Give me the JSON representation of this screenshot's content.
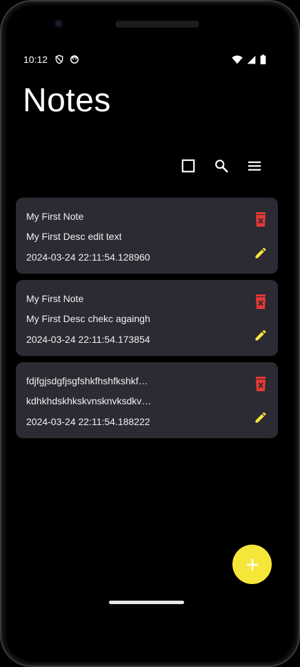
{
  "status_bar": {
    "time": "10:12",
    "icons_left": [
      "shield-icon",
      "face-icon"
    ],
    "icons_right": [
      "wifi-icon",
      "signal-icon",
      "battery-icon"
    ]
  },
  "app": {
    "title": "Notes"
  },
  "toolbar": {
    "icons": [
      "grid-view-icon",
      "search-icon",
      "menu-icon"
    ]
  },
  "notes": [
    {
      "title": "My First Note",
      "description": "My First Desc edit text",
      "date": "2024-03-24 22:11:54.128960"
    },
    {
      "title": "My First Note",
      "description": "My First Desc chekc againgh",
      "date": "2024-03-24 22:11:54.173854"
    },
    {
      "title": "fdjfgjsdgfjsgfshkfhshfkshkf…",
      "description": "kdhkhdskhkskvnsknvksdkv…",
      "date": "2024-03-24 22:11:54.188222"
    }
  ],
  "colors": {
    "background": "#000000",
    "card": "#2c2a33",
    "delete": "#e53935",
    "edit": "#f7e63a",
    "fab": "#f7e63a"
  },
  "fab": {
    "icon": "plus-icon"
  }
}
